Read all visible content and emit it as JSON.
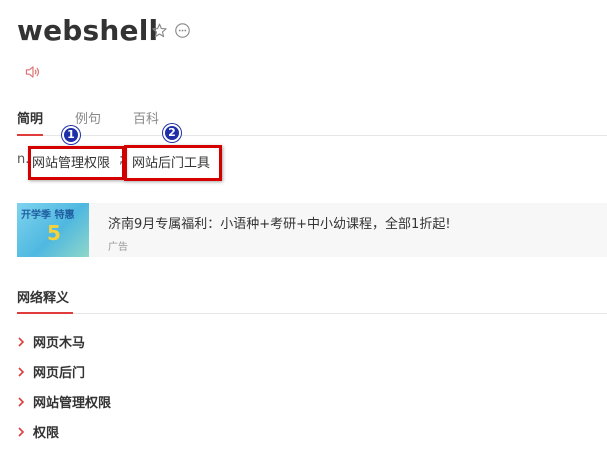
{
  "word": "webshell",
  "icons": {
    "favorite": "star-outline-icon",
    "more": "more-dots-icon",
    "pronounce": "speaker-icon"
  },
  "tabs": [
    {
      "label": "简明",
      "active": true
    },
    {
      "label": "例句",
      "active": false
    },
    {
      "label": "百科",
      "active": false
    }
  ],
  "definition": {
    "pos": "n.",
    "separator": ";",
    "items": [
      "网站管理权限",
      "网站后门工具"
    ]
  },
  "annotations": [
    "1",
    "2"
  ],
  "ad": {
    "thumb_text": "开学季 特惠",
    "thumb_number": "5",
    "title": "济南9月专属福利：小语种+考研+中小幼课程，全部1折起!",
    "label": "广告"
  },
  "network_section": {
    "title": "网络释义",
    "items": [
      "网页木马",
      "网页后门",
      "网站管理权限",
      "权限"
    ]
  },
  "colors": {
    "accent": "#e03c3c",
    "highlight": "#d40000",
    "badge": "#1f2fa8"
  }
}
